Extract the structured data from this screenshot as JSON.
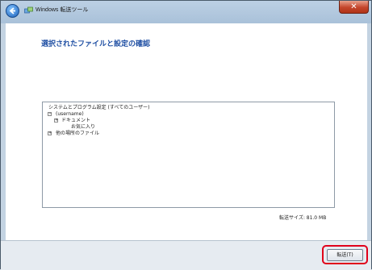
{
  "window": {
    "title": "Windows 転送ツール",
    "close_label": "✕"
  },
  "main": {
    "heading": "選択されたファイルと設定の確認",
    "tree": [
      {
        "label": "システムとプログラム設定 (すべてのユーザー)",
        "expander": ""
      },
      {
        "label": "(username)",
        "expander": "−"
      },
      {
        "label": "ドキュメント",
        "expander": "+"
      },
      {
        "label": "お気に入り",
        "expander": ""
      },
      {
        "label": "他の場所のファイル",
        "expander": "+"
      }
    ],
    "transfer_size": "転送サイズ: 81.0 MB"
  },
  "footer": {
    "transfer_button": "転送(T)"
  },
  "colors": {
    "heading": "#1f4fa3",
    "highlight": "#e0001b"
  }
}
